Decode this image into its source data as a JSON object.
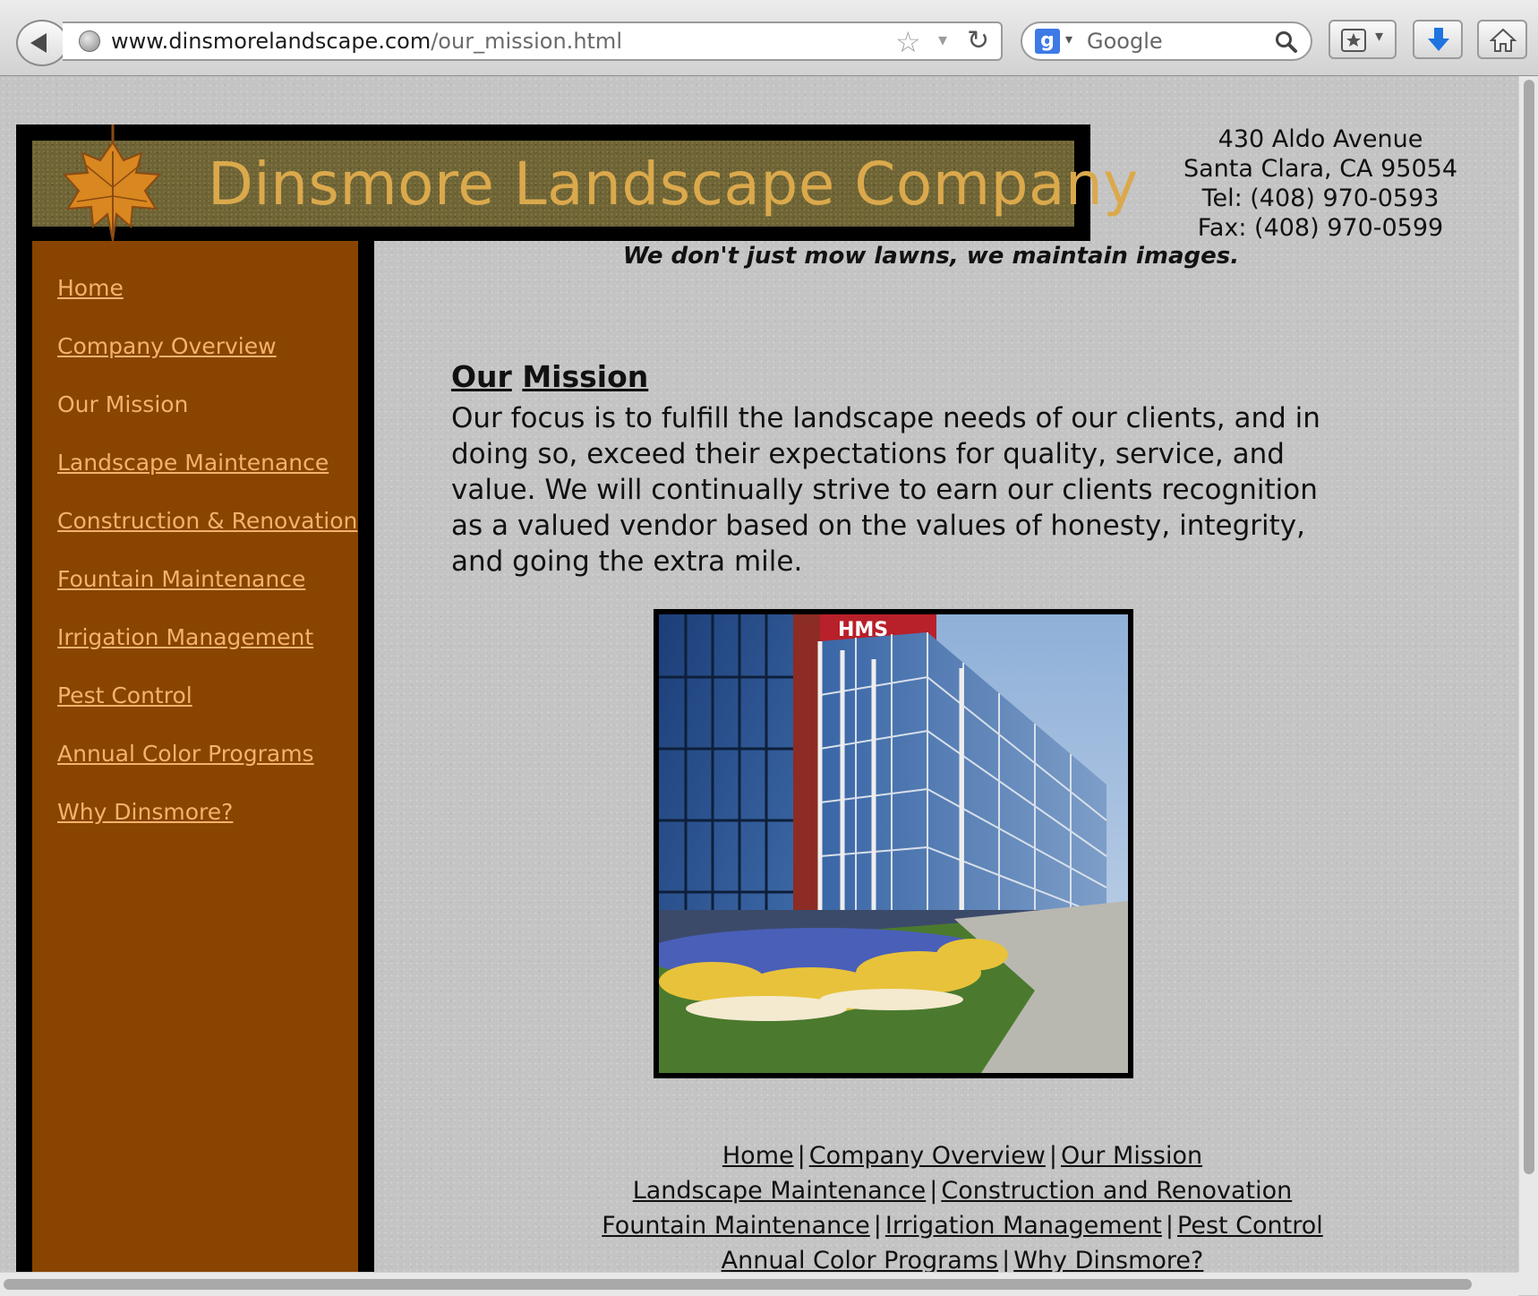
{
  "browser": {
    "url_host": "www.dinsmorelandscape.com",
    "url_path": "/our_mission.html",
    "search_placeholder": "Google"
  },
  "header": {
    "company_name": "Dinsmore Landscape Company",
    "address_lines": [
      "430 Aldo Avenue",
      "Santa Clara, CA 95054",
      "Tel: (408) 970-0593",
      "Fax: (408) 970-0599"
    ],
    "tagline": "We don't just mow lawns, we maintain images."
  },
  "sidebar": {
    "items": [
      {
        "label": "Home"
      },
      {
        "label": "Company Overview"
      },
      {
        "label": "Our Mission"
      },
      {
        "label": "Landscape Maintenance"
      },
      {
        "label": "Construction & Renovation"
      },
      {
        "label": "Fountain Maintenance"
      },
      {
        "label": "Irrigation Management"
      },
      {
        "label": "Pest Control"
      },
      {
        "label": "Annual Color Programs"
      },
      {
        "label": "Why Dinsmore?"
      }
    ]
  },
  "main": {
    "heading_word1": "Our",
    "heading_word2": "Mission",
    "body": "Our focus is to fulfill the landscape needs of our clients, and in doing so, exceed their expectations for quality, service, and value. We will continually strive to earn our clients recognition as a valued vendor based on the values of honesty, integrity, and going the extra mile."
  },
  "footer": {
    "rows": [
      [
        "Home",
        "Company Overview",
        "Our Mission"
      ],
      [
        "Landscape Maintenance",
        "Construction and Renovation"
      ],
      [
        "Fountain Maintenance",
        "Irrigation Management",
        "Pest Control"
      ],
      [
        "Annual Color Programs",
        "Why Dinsmore?"
      ]
    ],
    "separator": "|"
  }
}
